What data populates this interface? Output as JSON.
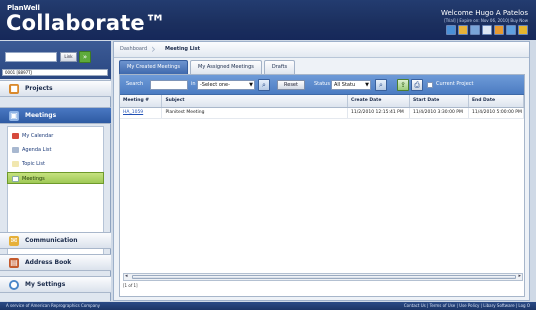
{
  "header": {
    "brand_small": "PlanWell",
    "brand_big": "Collaborate™",
    "welcome": "Welcome Hugo A Patelos",
    "trial_notice": "[Trial] | Expire on: Nov 06, 2010| Buy Now",
    "icons": [
      "home-icon",
      "help-icon",
      "print-icon",
      "close-icon",
      "users-icon",
      "tools-icon",
      "question-icon"
    ]
  },
  "sidebar": {
    "search_value": "",
    "link_label": "Link",
    "user_field": "0001 [8897TJ",
    "projects_label": "Projects",
    "meetings_label": "Meetings",
    "sub_items": [
      {
        "label": "My Calendar",
        "icon": "calendar-icon"
      },
      {
        "label": "Agenda List",
        "icon": "agenda-icon"
      },
      {
        "label": "Topic List",
        "icon": "topic-icon"
      },
      {
        "label": "Meetings",
        "icon": "meetings-icon"
      }
    ],
    "communication_label": "Communication",
    "address_book_label": "Address Book",
    "my_settings_label": "My Settings"
  },
  "main": {
    "breadcrumb_dashboard": "Dashboard",
    "breadcrumb_current": "Meeting List",
    "tabs": [
      "My Created Meetings",
      "My Assigned Meetings",
      "Drafts"
    ],
    "toolbar": {
      "search_label": "Search",
      "search_value": "",
      "in_label": "in",
      "select_value": "-Select one-",
      "reset_label": "Reset",
      "status_label": "Status",
      "status_value": "All Statu",
      "current_project_label": "Current Project"
    },
    "table": {
      "headers": [
        "Meeting #",
        "Subject",
        "Create Date",
        "Start Date",
        "End Date"
      ],
      "rows": [
        [
          "HA_1059",
          "Planitest Meeting",
          "11/2/2010 12:15:41 PM",
          "11/4/2010 3:30:00 PM",
          "11/4/2010 5:00:00 PM"
        ]
      ]
    },
    "pager": "[1 of 1]"
  },
  "footer": {
    "left": "A service of American Reprographics Company",
    "right": "Contact Us | Terms of Use | Use Policy | Libary Software | Log O"
  },
  "colors": {
    "header_bg": "#1b2f5e",
    "accent_blue": "#4c7cc2",
    "active_green": "#9fc956"
  }
}
